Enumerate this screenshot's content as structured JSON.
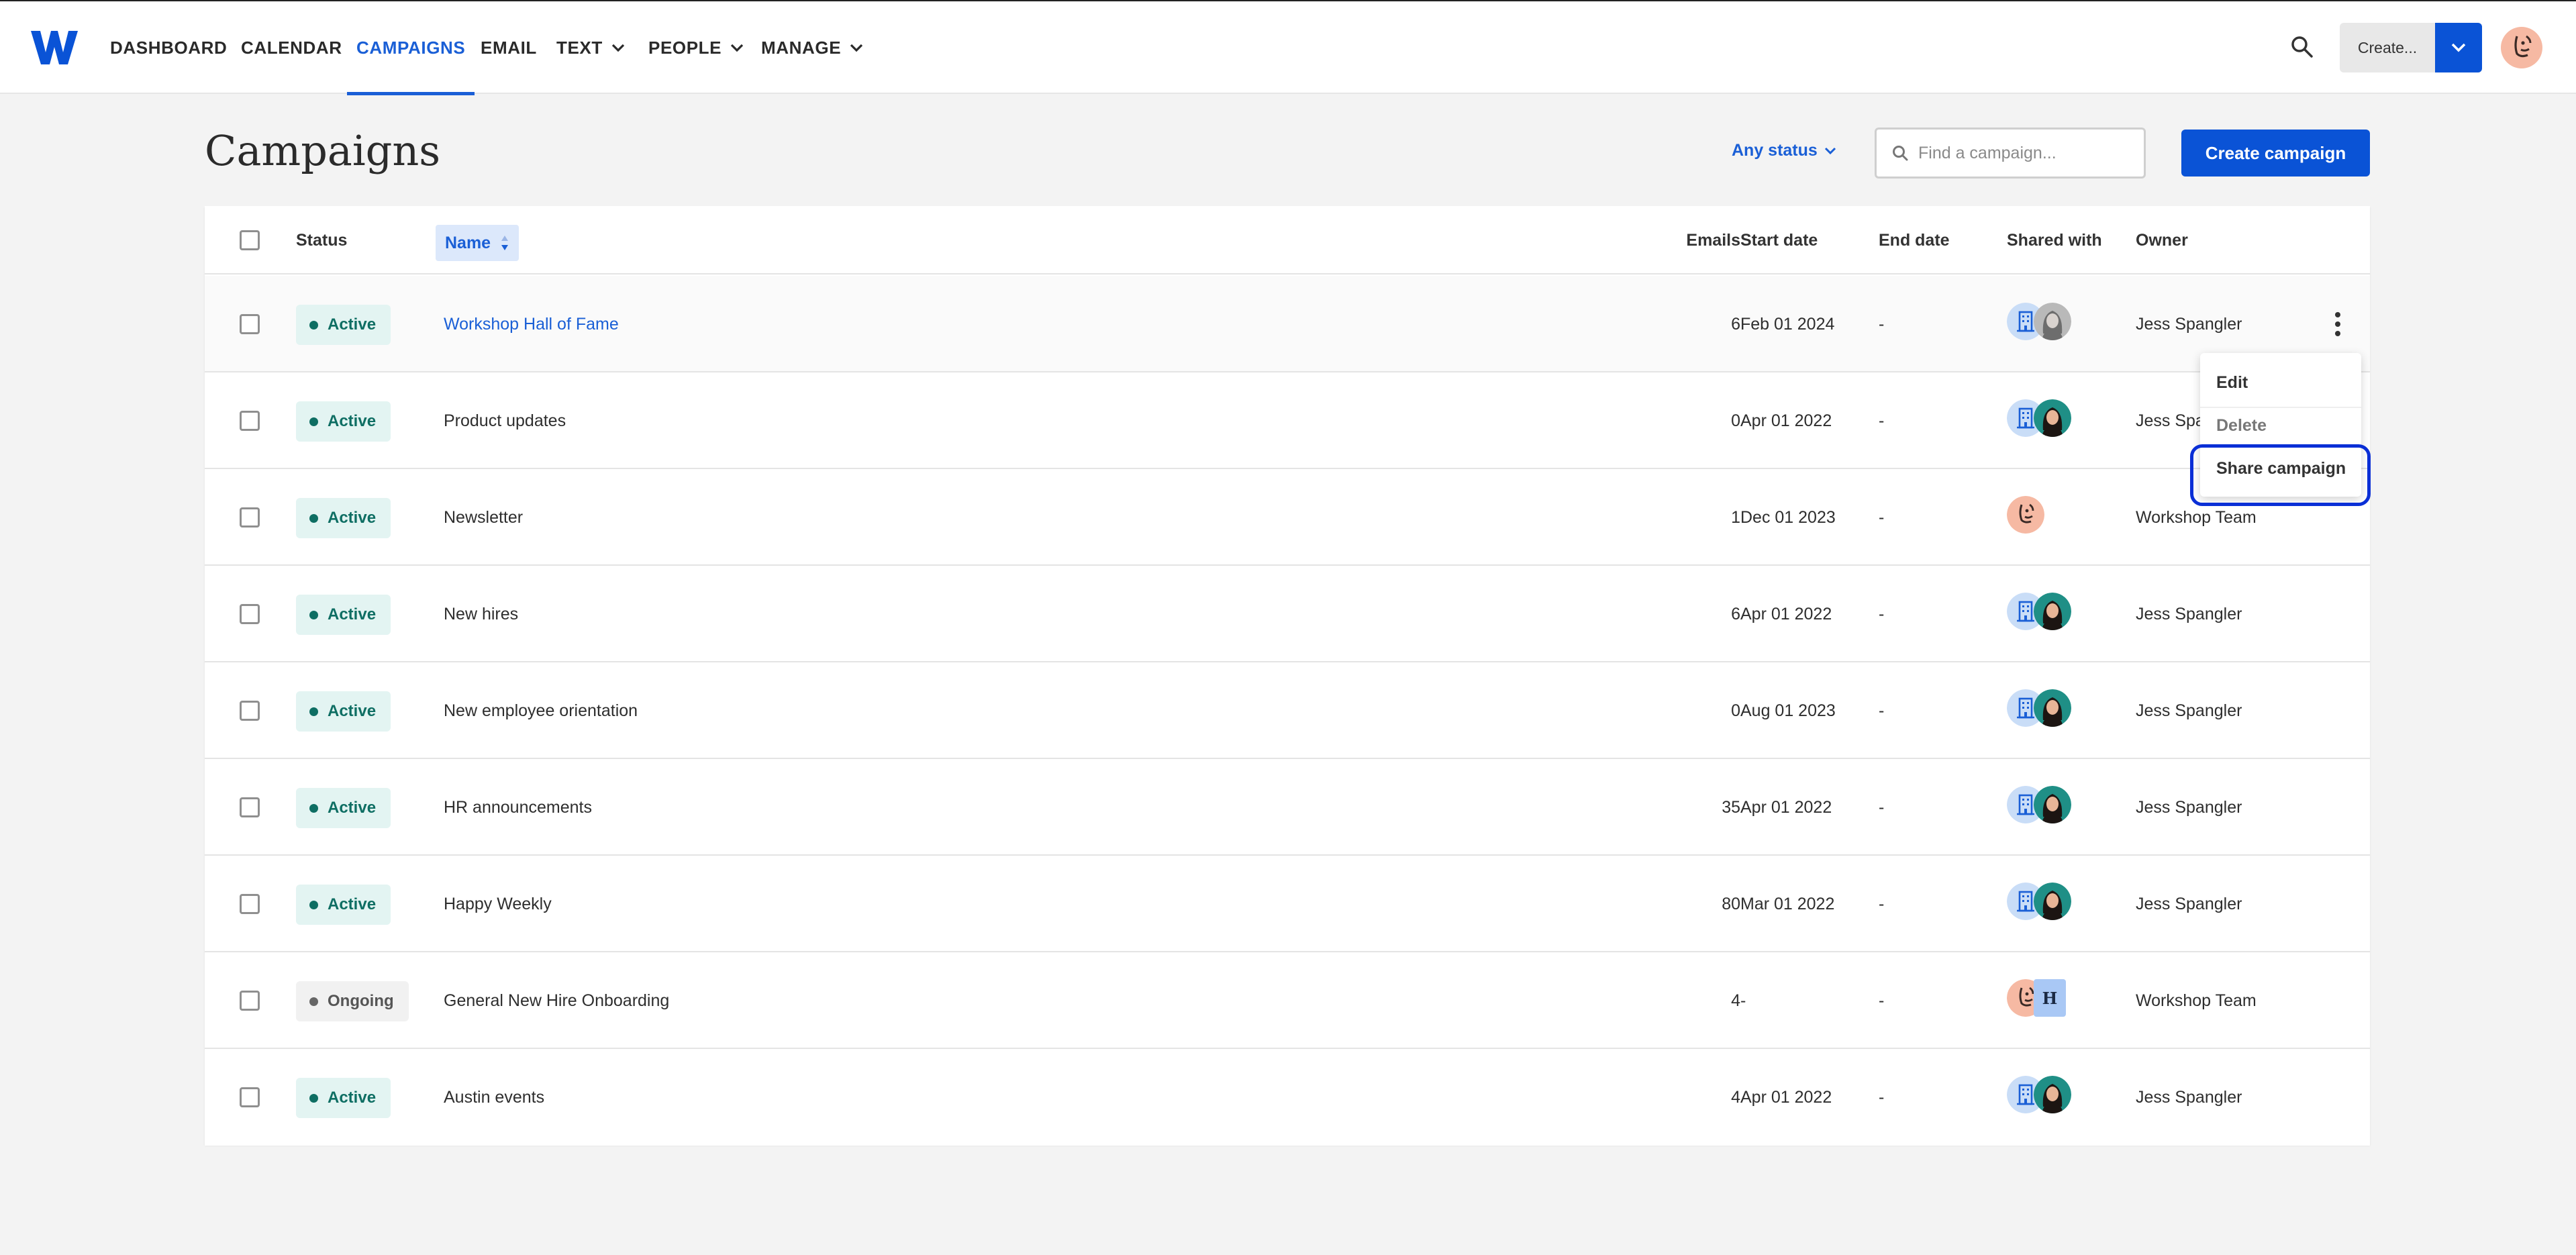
{
  "nav": {
    "items": [
      {
        "label": "DASHBOARD",
        "active": false,
        "dropdown": false
      },
      {
        "label": "CALENDAR",
        "active": false,
        "dropdown": false
      },
      {
        "label": "CAMPAIGNS",
        "active": true,
        "dropdown": false
      },
      {
        "label": "EMAIL",
        "active": false,
        "dropdown": false
      },
      {
        "label": "TEXT",
        "active": false,
        "dropdown": true
      },
      {
        "label": "PEOPLE",
        "active": false,
        "dropdown": true
      },
      {
        "label": "MANAGE",
        "active": false,
        "dropdown": true
      }
    ],
    "search_icon": "search-icon",
    "create_label": "Create...",
    "create_dropdown_icon": "chevron-down-icon"
  },
  "page": {
    "title": "Campaigns",
    "status_filter": "Any status",
    "search_placeholder": "Find a campaign...",
    "create_button": "Create campaign"
  },
  "table": {
    "headers": {
      "status": "Status",
      "name": "Name",
      "emails": "Emails",
      "start_date": "Start date",
      "end_date": "End date",
      "shared_with": "Shared with",
      "owner": "Owner"
    },
    "rows": [
      {
        "status": "Active",
        "name": "Workshop Hall of Fame",
        "emails": "6",
        "start": "Feb 01 2024",
        "end": "-",
        "owner": "Jess Spangler",
        "shared": [
          "building",
          "person-gray"
        ],
        "link": true
      },
      {
        "status": "Active",
        "name": "Product updates",
        "emails": "0",
        "start": "Apr 01 2022",
        "end": "-",
        "owner": "Jess Spa",
        "shared": [
          "building",
          "person"
        ],
        "link": false
      },
      {
        "status": "Active",
        "name": "Newsletter",
        "emails": "1",
        "start": "Dec 01 2023",
        "end": "-",
        "owner": "Workshop Team",
        "shared": [
          "smiley"
        ],
        "link": false
      },
      {
        "status": "Active",
        "name": "New hires",
        "emails": "6",
        "start": "Apr 01 2022",
        "end": "-",
        "owner": "Jess Spangler",
        "shared": [
          "building",
          "person"
        ],
        "link": false
      },
      {
        "status": "Active",
        "name": "New employee orientation",
        "emails": "0",
        "start": "Aug 01 2023",
        "end": "-",
        "owner": "Jess Spangler",
        "shared": [
          "building",
          "person"
        ],
        "link": false
      },
      {
        "status": "Active",
        "name": "HR announcements",
        "emails": "35",
        "start": "Apr 01 2022",
        "end": "-",
        "owner": "Jess Spangler",
        "shared": [
          "building",
          "person"
        ],
        "link": false
      },
      {
        "status": "Active",
        "name": "Happy Weekly",
        "emails": "80",
        "start": "Mar 01 2022",
        "end": "-",
        "owner": "Jess Spangler",
        "shared": [
          "building",
          "person"
        ],
        "link": false
      },
      {
        "status": "Ongoing",
        "name": "General New Hire Onboarding",
        "emails": "4",
        "start": "-",
        "end": "-",
        "owner": "Workshop Team",
        "shared": [
          "smiley",
          "letter-h"
        ],
        "link": false
      },
      {
        "status": "Active",
        "name": "Austin events",
        "emails": "4",
        "start": "Apr 01 2022",
        "end": "-",
        "owner": "Jess Spangler",
        "shared": [
          "building",
          "person"
        ],
        "link": false
      }
    ]
  },
  "row_menu": {
    "items": [
      "Edit",
      "Delete",
      "Share campaign"
    ]
  },
  "avatar_letter": "H",
  "colors": {
    "accent": "#1a5fd6",
    "primary_button": "#0a53d6",
    "active_badge_bg": "#e3f4f2",
    "active_badge_text": "#0e6e63",
    "focus_ring": "#0a2fd6"
  }
}
